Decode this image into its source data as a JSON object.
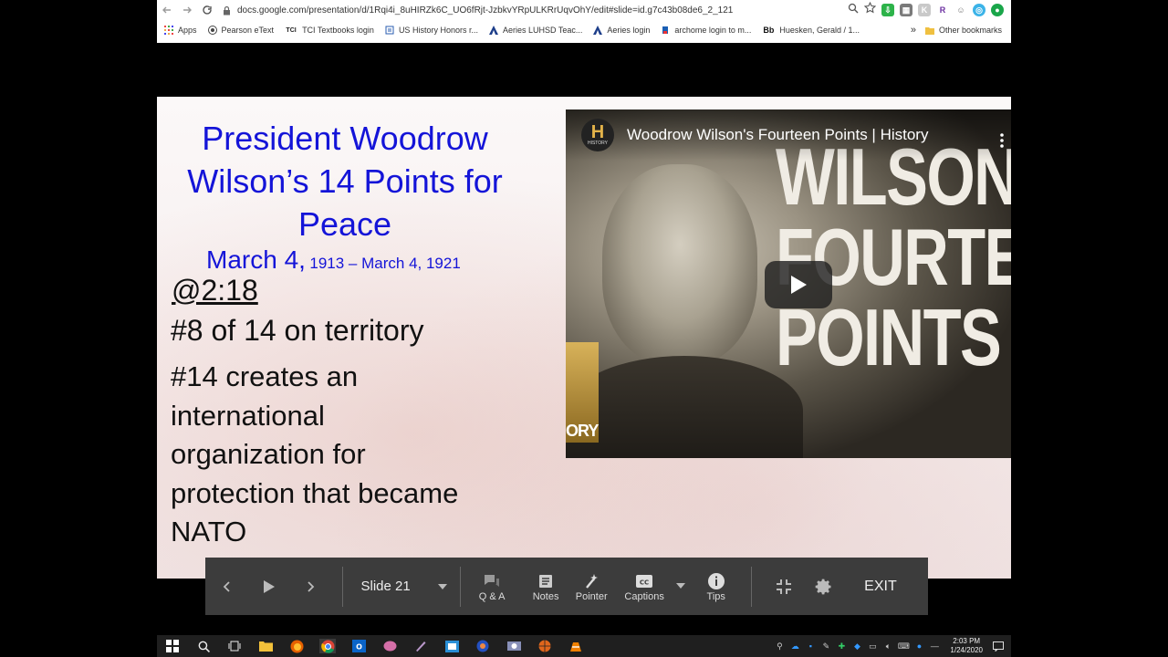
{
  "browser": {
    "url": "docs.google.com/presentation/d/1Rqi4i_8uHIRZk6C_UO6fRjt-JzbkvYRpULKRrUqvOhY/edit#slide=id.g7c43b08de6_2_121",
    "bookmarks": [
      {
        "label": "Apps",
        "icon": "apps-grid-icon"
      },
      {
        "label": "Pearson eText",
        "icon": "pearson-icon"
      },
      {
        "label": "TCI Textbooks login",
        "icon": "tci-icon"
      },
      {
        "label": "US History Honors r...",
        "icon": "doc-icon"
      },
      {
        "label": "Aeries LUHSD Teac...",
        "icon": "aeries-icon"
      },
      {
        "label": "Aeries login",
        "icon": "aeries-icon"
      },
      {
        "label": "archome login to m...",
        "icon": "archome-icon"
      },
      {
        "label": "Huesken, Gerald / 1...",
        "icon": "blackboard-icon"
      }
    ],
    "bb_prefix": "Bb",
    "tci_prefix": "TCI",
    "overflow": "»",
    "other_bookmarks": "Other bookmarks"
  },
  "slide": {
    "title": "President Woodrow Wilson’s 14 Points for Peace",
    "date_start": "March 4,",
    "date_rest": "1913 – March 4, 1921",
    "timestamp": "@2:18",
    "point8": "#8 of 14 on territory",
    "point14": "#14 creates an international organization for protection that became NATO"
  },
  "video": {
    "title": "Woodrow Wilson's Fourteen Points | History",
    "channel_letter": "H",
    "channel_name": "HISTORY",
    "thumb_words": "WILSON\nFOURTEEN\nPOINTS",
    "side_text": "ORY"
  },
  "controls": {
    "slide_label": "Slide 21",
    "qa": "Q & A",
    "notes": "Notes",
    "pointer": "Pointer",
    "captions": "Captions",
    "tips": "Tips",
    "exit": "EXIT"
  },
  "taskbar": {
    "time": "2:03 PM",
    "date": "1/24/2020"
  },
  "colors": {
    "title_blue": "#1414d8",
    "control_bar": "#3c3c3c"
  }
}
